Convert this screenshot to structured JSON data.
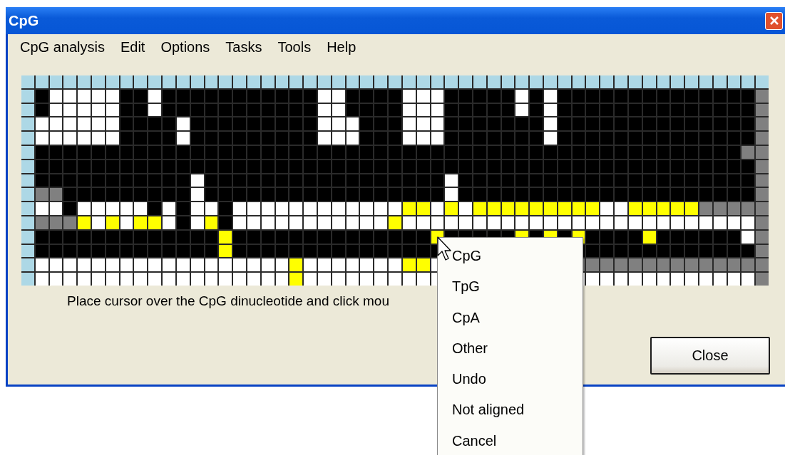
{
  "window": {
    "title": "CpG"
  },
  "menu_bar": [
    "CpG analysis",
    "Edit",
    "Options",
    "Tasks",
    "Tools",
    "Help"
  ],
  "grid": {
    "rows": [
      [
        {
          "color": "#add8e6"
        },
        {
          "color": "#add8e6"
        },
        {
          "color": "#add8e6"
        },
        {
          "color": "#add8e6"
        },
        {
          "color": "#add8e6"
        },
        {
          "color": "#add8e6"
        },
        {
          "color": "#add8e6"
        },
        {
          "color": "#add8e6"
        },
        {
          "color": "#add8e6"
        },
        {
          "color": "#add8e6"
        },
        {
          "color": "#add8e6"
        },
        {
          "color": "#add8e6"
        },
        {
          "color": "#add8e6"
        },
        {
          "color": "#add8e6"
        },
        {
          "color": "#add8e6"
        },
        {
          "color": "#add8e6"
        },
        {
          "color": "#add8e6"
        },
        {
          "color": "#add8e6"
        },
        {
          "color": "#add8e6"
        },
        {
          "color": "#add8e6"
        },
        {
          "color": "#add8e6"
        },
        {
          "color": "#add8e6"
        },
        {
          "color": "#add8e6"
        },
        {
          "color": "#add8e6"
        },
        {
          "color": "#add8e6"
        },
        {
          "color": "#add8e6"
        },
        {
          "color": "#add8e6"
        },
        {
          "color": "#add8e6"
        },
        {
          "color": "#add8e6"
        },
        {
          "color": "#add8e6"
        },
        {
          "color": "#add8e6"
        },
        {
          "color": "#add8e6"
        },
        {
          "color": "#add8e6"
        },
        {
          "color": "#add8e6"
        },
        {
          "color": "#add8e6"
        },
        {
          "color": "#add8e6"
        },
        {
          "color": "#add8e6"
        },
        {
          "color": "#add8e6"
        },
        {
          "color": "#add8e6"
        },
        {
          "color": "#add8e6"
        },
        {
          "color": "#add8e6"
        },
        {
          "color": "#add8e6"
        },
        {
          "color": "#add8e6"
        },
        {
          "color": "#add8e6"
        },
        {
          "color": "#add8e6"
        },
        {
          "color": "#add8e6"
        },
        {
          "color": "#add8e6"
        },
        {
          "color": "#add8e6"
        },
        {
          "color": "#add8e6"
        },
        {
          "color": "#add8e6"
        },
        {
          "color": "#add8e6"
        },
        {
          "color": "#add8e6"
        },
        {
          "color": "#add8e6"
        }
      ],
      [
        {
          "color": "#add8e6"
        },
        {
          "color": "#000000"
        },
        {
          "color": "#ffffff"
        },
        {
          "color": "#ffffff"
        },
        {
          "color": "#ffffff"
        },
        {
          "color": "#ffffff"
        },
        {
          "color": "#ffffff"
        },
        {
          "color": "#000000"
        },
        {
          "color": "#000000"
        },
        {
          "color": "#ffffff"
        },
        {
          "color": "#000000"
        },
        {
          "color": "#000000"
        },
        {
          "color": "#000000"
        },
        {
          "color": "#000000"
        },
        {
          "color": "#000000"
        },
        {
          "color": "#000000"
        },
        {
          "color": "#000000"
        },
        {
          "color": "#000000"
        },
        {
          "color": "#000000"
        },
        {
          "color": "#000000"
        },
        {
          "color": "#000000"
        },
        {
          "color": "#ffffff"
        },
        {
          "color": "#ffffff"
        },
        {
          "color": "#000000"
        },
        {
          "color": "#000000"
        },
        {
          "color": "#000000"
        },
        {
          "color": "#000000"
        },
        {
          "color": "#ffffff"
        },
        {
          "color": "#ffffff"
        },
        {
          "color": "#ffffff"
        },
        {
          "color": "#000000"
        },
        {
          "color": "#000000"
        },
        {
          "color": "#000000"
        },
        {
          "color": "#000000"
        },
        {
          "color": "#000000"
        },
        {
          "color": "#ffffff"
        },
        {
          "color": "#000000"
        },
        {
          "color": "#ffffff"
        },
        {
          "color": "#000000"
        },
        {
          "color": "#000000"
        },
        {
          "color": "#000000"
        },
        {
          "color": "#000000"
        },
        {
          "color": "#000000"
        },
        {
          "color": "#000000"
        },
        {
          "color": "#000000"
        },
        {
          "color": "#000000"
        },
        {
          "color": "#000000"
        },
        {
          "color": "#000000"
        },
        {
          "color": "#000000"
        },
        {
          "color": "#000000"
        },
        {
          "color": "#000000"
        },
        {
          "color": "#000000"
        },
        {
          "color": "#808080"
        }
      ],
      [
        {
          "color": "#add8e6"
        },
        {
          "color": "#000000"
        },
        {
          "color": "#ffffff"
        },
        {
          "color": "#ffffff"
        },
        {
          "color": "#ffffff"
        },
        {
          "color": "#ffffff"
        },
        {
          "color": "#ffffff"
        },
        {
          "color": "#000000"
        },
        {
          "color": "#000000"
        },
        {
          "color": "#ffffff"
        },
        {
          "color": "#000000"
        },
        {
          "color": "#000000"
        },
        {
          "color": "#000000"
        },
        {
          "color": "#000000"
        },
        {
          "color": "#000000"
        },
        {
          "color": "#000000"
        },
        {
          "color": "#000000"
        },
        {
          "color": "#000000"
        },
        {
          "color": "#000000"
        },
        {
          "color": "#000000"
        },
        {
          "color": "#000000"
        },
        {
          "color": "#ffffff"
        },
        {
          "color": "#ffffff"
        },
        {
          "color": "#000000"
        },
        {
          "color": "#000000"
        },
        {
          "color": "#000000"
        },
        {
          "color": "#000000"
        },
        {
          "color": "#ffffff"
        },
        {
          "color": "#ffffff"
        },
        {
          "color": "#ffffff"
        },
        {
          "color": "#000000"
        },
        {
          "color": "#000000"
        },
        {
          "color": "#000000"
        },
        {
          "color": "#000000"
        },
        {
          "color": "#000000"
        },
        {
          "color": "#ffffff"
        },
        {
          "color": "#000000"
        },
        {
          "color": "#ffffff"
        },
        {
          "color": "#000000"
        },
        {
          "color": "#000000"
        },
        {
          "color": "#000000"
        },
        {
          "color": "#000000"
        },
        {
          "color": "#000000"
        },
        {
          "color": "#000000"
        },
        {
          "color": "#000000"
        },
        {
          "color": "#000000"
        },
        {
          "color": "#000000"
        },
        {
          "color": "#000000"
        },
        {
          "color": "#000000"
        },
        {
          "color": "#000000"
        },
        {
          "color": "#000000"
        },
        {
          "color": "#000000"
        },
        {
          "color": "#808080"
        }
      ],
      [
        {
          "color": "#add8e6"
        },
        {
          "color": "#ffffff"
        },
        {
          "color": "#ffffff"
        },
        {
          "color": "#ffffff"
        },
        {
          "color": "#ffffff"
        },
        {
          "color": "#ffffff"
        },
        {
          "color": "#ffffff"
        },
        {
          "color": "#000000"
        },
        {
          "color": "#000000"
        },
        {
          "color": "#000000"
        },
        {
          "color": "#000000"
        },
        {
          "color": "#ffffff"
        },
        {
          "color": "#000000"
        },
        {
          "color": "#000000"
        },
        {
          "color": "#000000"
        },
        {
          "color": "#000000"
        },
        {
          "color": "#000000"
        },
        {
          "color": "#000000"
        },
        {
          "color": "#000000"
        },
        {
          "color": "#000000"
        },
        {
          "color": "#000000"
        },
        {
          "color": "#ffffff"
        },
        {
          "color": "#ffffff"
        },
        {
          "color": "#ffffff"
        },
        {
          "color": "#000000"
        },
        {
          "color": "#000000"
        },
        {
          "color": "#000000"
        },
        {
          "color": "#ffffff"
        },
        {
          "color": "#ffffff"
        },
        {
          "color": "#ffffff"
        },
        {
          "color": "#000000"
        },
        {
          "color": "#000000"
        },
        {
          "color": "#000000"
        },
        {
          "color": "#000000"
        },
        {
          "color": "#000000"
        },
        {
          "color": "#000000"
        },
        {
          "color": "#000000"
        },
        {
          "color": "#ffffff"
        },
        {
          "color": "#000000"
        },
        {
          "color": "#000000"
        },
        {
          "color": "#000000"
        },
        {
          "color": "#000000"
        },
        {
          "color": "#000000"
        },
        {
          "color": "#000000"
        },
        {
          "color": "#000000"
        },
        {
          "color": "#000000"
        },
        {
          "color": "#000000"
        },
        {
          "color": "#000000"
        },
        {
          "color": "#000000"
        },
        {
          "color": "#000000"
        },
        {
          "color": "#000000"
        },
        {
          "color": "#000000"
        },
        {
          "color": "#808080"
        }
      ],
      [
        {
          "color": "#add8e6"
        },
        {
          "color": "#ffffff"
        },
        {
          "color": "#ffffff"
        },
        {
          "color": "#ffffff"
        },
        {
          "color": "#ffffff"
        },
        {
          "color": "#ffffff"
        },
        {
          "color": "#ffffff"
        },
        {
          "color": "#000000"
        },
        {
          "color": "#000000"
        },
        {
          "color": "#000000"
        },
        {
          "color": "#000000"
        },
        {
          "color": "#ffffff"
        },
        {
          "color": "#000000"
        },
        {
          "color": "#000000"
        },
        {
          "color": "#000000"
        },
        {
          "color": "#000000"
        },
        {
          "color": "#000000"
        },
        {
          "color": "#000000"
        },
        {
          "color": "#000000"
        },
        {
          "color": "#000000"
        },
        {
          "color": "#000000"
        },
        {
          "color": "#ffffff"
        },
        {
          "color": "#ffffff"
        },
        {
          "color": "#ffffff"
        },
        {
          "color": "#000000"
        },
        {
          "color": "#000000"
        },
        {
          "color": "#000000"
        },
        {
          "color": "#ffffff"
        },
        {
          "color": "#ffffff"
        },
        {
          "color": "#ffffff"
        },
        {
          "color": "#000000"
        },
        {
          "color": "#000000"
        },
        {
          "color": "#000000"
        },
        {
          "color": "#000000"
        },
        {
          "color": "#000000"
        },
        {
          "color": "#000000"
        },
        {
          "color": "#000000"
        },
        {
          "color": "#ffffff"
        },
        {
          "color": "#000000"
        },
        {
          "color": "#000000"
        },
        {
          "color": "#000000"
        },
        {
          "color": "#000000"
        },
        {
          "color": "#000000"
        },
        {
          "color": "#000000"
        },
        {
          "color": "#000000"
        },
        {
          "color": "#000000"
        },
        {
          "color": "#000000"
        },
        {
          "color": "#000000"
        },
        {
          "color": "#000000"
        },
        {
          "color": "#000000"
        },
        {
          "color": "#000000"
        },
        {
          "color": "#000000"
        },
        {
          "color": "#808080"
        }
      ],
      [
        {
          "color": "#add8e6"
        },
        {
          "color": "#000000"
        },
        {
          "color": "#000000"
        },
        {
          "color": "#000000"
        },
        {
          "color": "#000000"
        },
        {
          "color": "#000000"
        },
        {
          "color": "#000000"
        },
        {
          "color": "#000000"
        },
        {
          "color": "#000000"
        },
        {
          "color": "#000000"
        },
        {
          "color": "#000000"
        },
        {
          "color": "#000000"
        },
        {
          "color": "#000000"
        },
        {
          "color": "#000000"
        },
        {
          "color": "#000000"
        },
        {
          "color": "#000000"
        },
        {
          "color": "#000000"
        },
        {
          "color": "#000000"
        },
        {
          "color": "#000000"
        },
        {
          "color": "#000000"
        },
        {
          "color": "#000000"
        },
        {
          "color": "#000000"
        },
        {
          "color": "#000000"
        },
        {
          "color": "#000000"
        },
        {
          "color": "#000000"
        },
        {
          "color": "#000000"
        },
        {
          "color": "#000000"
        },
        {
          "color": "#000000"
        },
        {
          "color": "#000000"
        },
        {
          "color": "#000000"
        },
        {
          "color": "#000000"
        },
        {
          "color": "#000000"
        },
        {
          "color": "#000000"
        },
        {
          "color": "#000000"
        },
        {
          "color": "#000000"
        },
        {
          "color": "#000000"
        },
        {
          "color": "#000000"
        },
        {
          "color": "#000000"
        },
        {
          "color": "#000000"
        },
        {
          "color": "#000000"
        },
        {
          "color": "#000000"
        },
        {
          "color": "#000000"
        },
        {
          "color": "#000000"
        },
        {
          "color": "#000000"
        },
        {
          "color": "#000000"
        },
        {
          "color": "#000000"
        },
        {
          "color": "#000000"
        },
        {
          "color": "#000000"
        },
        {
          "color": "#000000"
        },
        {
          "color": "#000000"
        },
        {
          "color": "#000000"
        },
        {
          "color": "#808080"
        },
        {
          "color": "#808080"
        }
      ],
      [
        {
          "color": "#add8e6"
        },
        {
          "color": "#000000"
        },
        {
          "color": "#000000"
        },
        {
          "color": "#000000"
        },
        {
          "color": "#000000"
        },
        {
          "color": "#000000"
        },
        {
          "color": "#000000"
        },
        {
          "color": "#000000"
        },
        {
          "color": "#000000"
        },
        {
          "color": "#000000"
        },
        {
          "color": "#000000"
        },
        {
          "color": "#000000"
        },
        {
          "color": "#000000"
        },
        {
          "color": "#000000"
        },
        {
          "color": "#000000"
        },
        {
          "color": "#000000"
        },
        {
          "color": "#000000"
        },
        {
          "color": "#000000"
        },
        {
          "color": "#000000"
        },
        {
          "color": "#000000"
        },
        {
          "color": "#000000"
        },
        {
          "color": "#000000"
        },
        {
          "color": "#000000"
        },
        {
          "color": "#000000"
        },
        {
          "color": "#000000"
        },
        {
          "color": "#000000"
        },
        {
          "color": "#000000"
        },
        {
          "color": "#000000"
        },
        {
          "color": "#000000"
        },
        {
          "color": "#000000"
        },
        {
          "color": "#000000"
        },
        {
          "color": "#000000"
        },
        {
          "color": "#000000"
        },
        {
          "color": "#000000"
        },
        {
          "color": "#000000"
        },
        {
          "color": "#000000"
        },
        {
          "color": "#000000"
        },
        {
          "color": "#000000"
        },
        {
          "color": "#000000"
        },
        {
          "color": "#000000"
        },
        {
          "color": "#000000"
        },
        {
          "color": "#000000"
        },
        {
          "color": "#000000"
        },
        {
          "color": "#000000"
        },
        {
          "color": "#000000"
        },
        {
          "color": "#000000"
        },
        {
          "color": "#000000"
        },
        {
          "color": "#000000"
        },
        {
          "color": "#000000"
        },
        {
          "color": "#000000"
        },
        {
          "color": "#000000"
        },
        {
          "color": "#000000"
        },
        {
          "color": "#808080"
        }
      ],
      [
        {
          "color": "#add8e6"
        },
        {
          "color": "#000000"
        },
        {
          "color": "#000000"
        },
        {
          "color": "#000000"
        },
        {
          "color": "#000000"
        },
        {
          "color": "#000000"
        },
        {
          "color": "#000000"
        },
        {
          "color": "#000000"
        },
        {
          "color": "#000000"
        },
        {
          "color": "#000000"
        },
        {
          "color": "#000000"
        },
        {
          "color": "#000000"
        },
        {
          "color": "#ffffff"
        },
        {
          "color": "#000000"
        },
        {
          "color": "#000000"
        },
        {
          "color": "#000000"
        },
        {
          "color": "#000000"
        },
        {
          "color": "#000000"
        },
        {
          "color": "#000000"
        },
        {
          "color": "#000000"
        },
        {
          "color": "#000000"
        },
        {
          "color": "#000000"
        },
        {
          "color": "#000000"
        },
        {
          "color": "#000000"
        },
        {
          "color": "#000000"
        },
        {
          "color": "#000000"
        },
        {
          "color": "#000000"
        },
        {
          "color": "#000000"
        },
        {
          "color": "#000000"
        },
        {
          "color": "#000000"
        },
        {
          "color": "#ffffff"
        },
        {
          "color": "#000000"
        },
        {
          "color": "#000000"
        },
        {
          "color": "#000000"
        },
        {
          "color": "#000000"
        },
        {
          "color": "#000000"
        },
        {
          "color": "#000000"
        },
        {
          "color": "#000000"
        },
        {
          "color": "#000000"
        },
        {
          "color": "#000000"
        },
        {
          "color": "#000000"
        },
        {
          "color": "#000000"
        },
        {
          "color": "#000000"
        },
        {
          "color": "#000000"
        },
        {
          "color": "#000000"
        },
        {
          "color": "#000000"
        },
        {
          "color": "#000000"
        },
        {
          "color": "#000000"
        },
        {
          "color": "#000000"
        },
        {
          "color": "#000000"
        },
        {
          "color": "#000000"
        },
        {
          "color": "#000000"
        },
        {
          "color": "#808080"
        }
      ],
      [
        {
          "color": "#add8e6"
        },
        {
          "color": "#808080"
        },
        {
          "color": "#808080"
        },
        {
          "color": "#000000"
        },
        {
          "color": "#000000"
        },
        {
          "color": "#000000"
        },
        {
          "color": "#000000"
        },
        {
          "color": "#000000"
        },
        {
          "color": "#000000"
        },
        {
          "color": "#000000"
        },
        {
          "color": "#000000"
        },
        {
          "color": "#000000"
        },
        {
          "color": "#ffffff"
        },
        {
          "color": "#000000"
        },
        {
          "color": "#000000"
        },
        {
          "color": "#000000"
        },
        {
          "color": "#000000"
        },
        {
          "color": "#000000"
        },
        {
          "color": "#000000"
        },
        {
          "color": "#000000"
        },
        {
          "color": "#000000"
        },
        {
          "color": "#000000"
        },
        {
          "color": "#000000"
        },
        {
          "color": "#000000"
        },
        {
          "color": "#000000"
        },
        {
          "color": "#000000"
        },
        {
          "color": "#000000"
        },
        {
          "color": "#000000"
        },
        {
          "color": "#000000"
        },
        {
          "color": "#000000"
        },
        {
          "color": "#ffffff"
        },
        {
          "color": "#000000"
        },
        {
          "color": "#000000"
        },
        {
          "color": "#000000"
        },
        {
          "color": "#000000"
        },
        {
          "color": "#000000"
        },
        {
          "color": "#000000"
        },
        {
          "color": "#000000"
        },
        {
          "color": "#000000"
        },
        {
          "color": "#000000"
        },
        {
          "color": "#000000"
        },
        {
          "color": "#000000"
        },
        {
          "color": "#000000"
        },
        {
          "color": "#000000"
        },
        {
          "color": "#000000"
        },
        {
          "color": "#000000"
        },
        {
          "color": "#000000"
        },
        {
          "color": "#000000"
        },
        {
          "color": "#000000"
        },
        {
          "color": "#000000"
        },
        {
          "color": "#000000"
        },
        {
          "color": "#000000"
        },
        {
          "color": "#808080"
        }
      ],
      [
        {
          "color": "#add8e6"
        },
        {
          "color": "#ffffff"
        },
        {
          "color": "#ffffff"
        },
        {
          "color": "#000000"
        },
        {
          "color": "#ffffff"
        },
        {
          "color": "#ffffff"
        },
        {
          "color": "#ffffff"
        },
        {
          "color": "#ffffff"
        },
        {
          "color": "#ffffff"
        },
        {
          "color": "#000000"
        },
        {
          "color": "#ffffff"
        },
        {
          "color": "#000000"
        },
        {
          "color": "#ffffff"
        },
        {
          "color": "#ffffff"
        },
        {
          "color": "#000000"
        },
        {
          "color": "#ffffff"
        },
        {
          "color": "#ffffff"
        },
        {
          "color": "#ffffff"
        },
        {
          "color": "#ffffff"
        },
        {
          "color": "#ffffff"
        },
        {
          "color": "#ffffff"
        },
        {
          "color": "#ffffff"
        },
        {
          "color": "#ffffff"
        },
        {
          "color": "#ffffff"
        },
        {
          "color": "#ffffff"
        },
        {
          "color": "#ffffff"
        },
        {
          "color": "#ffffff"
        },
        {
          "color": "#ffff00"
        },
        {
          "color": "#ffff00"
        },
        {
          "color": "#ffffff"
        },
        {
          "color": "#ffff00"
        },
        {
          "color": "#ffffff"
        },
        {
          "color": "#ffff00"
        },
        {
          "color": "#ffff00"
        },
        {
          "color": "#ffff00"
        },
        {
          "color": "#ffff00"
        },
        {
          "color": "#ffff00"
        },
        {
          "color": "#ffff00"
        },
        {
          "color": "#ffff00"
        },
        {
          "color": "#ffff00"
        },
        {
          "color": "#ffff00"
        },
        {
          "color": "#ffffff"
        },
        {
          "color": "#ffffff"
        },
        {
          "color": "#ffff00"
        },
        {
          "color": "#ffff00"
        },
        {
          "color": "#ffff00"
        },
        {
          "color": "#ffff00"
        },
        {
          "color": "#ffff00"
        },
        {
          "color": "#808080"
        },
        {
          "color": "#808080"
        },
        {
          "color": "#808080"
        },
        {
          "color": "#808080"
        },
        {
          "color": "#808080"
        }
      ],
      [
        {
          "color": "#add8e6"
        },
        {
          "color": "#808080"
        },
        {
          "color": "#808080"
        },
        {
          "color": "#808080"
        },
        {
          "color": "#ffff00"
        },
        {
          "color": "#ffffff"
        },
        {
          "color": "#ffff00"
        },
        {
          "color": "#ffffff"
        },
        {
          "color": "#ffff00"
        },
        {
          "color": "#ffff00"
        },
        {
          "color": "#ffffff"
        },
        {
          "color": "#000000"
        },
        {
          "color": "#ffffff"
        },
        {
          "color": "#ffff00"
        },
        {
          "color": "#000000"
        },
        {
          "color": "#ffffff"
        },
        {
          "color": "#ffffff"
        },
        {
          "color": "#ffffff"
        },
        {
          "color": "#ffffff"
        },
        {
          "color": "#ffffff"
        },
        {
          "color": "#ffffff"
        },
        {
          "color": "#ffffff"
        },
        {
          "color": "#ffffff"
        },
        {
          "color": "#ffffff"
        },
        {
          "color": "#ffffff"
        },
        {
          "color": "#ffffff"
        },
        {
          "color": "#ffff00"
        },
        {
          "color": "#ffffff"
        },
        {
          "color": "#ffffff"
        },
        {
          "color": "#ffffff"
        },
        {
          "color": "#ffffff"
        },
        {
          "color": "#ffffff"
        },
        {
          "color": "#ffffff"
        },
        {
          "color": "#ffffff"
        },
        {
          "color": "#ffffff"
        },
        {
          "color": "#ffffff"
        },
        {
          "color": "#ffffff"
        },
        {
          "color": "#ffffff"
        },
        {
          "color": "#ffffff"
        },
        {
          "color": "#ffffff"
        },
        {
          "color": "#ffffff"
        },
        {
          "color": "#ffffff"
        },
        {
          "color": "#ffffff"
        },
        {
          "color": "#ffffff"
        },
        {
          "color": "#ffffff"
        },
        {
          "color": "#ffffff"
        },
        {
          "color": "#ffffff"
        },
        {
          "color": "#ffffff"
        },
        {
          "color": "#ffffff"
        },
        {
          "color": "#ffffff"
        },
        {
          "color": "#ffffff"
        },
        {
          "color": "#ffffff"
        },
        {
          "color": "#808080"
        }
      ],
      [
        {
          "color": "#add8e6"
        },
        {
          "color": "#000000"
        },
        {
          "color": "#000000"
        },
        {
          "color": "#000000"
        },
        {
          "color": "#000000"
        },
        {
          "color": "#000000"
        },
        {
          "color": "#000000"
        },
        {
          "color": "#000000"
        },
        {
          "color": "#000000"
        },
        {
          "color": "#000000"
        },
        {
          "color": "#000000"
        },
        {
          "color": "#000000"
        },
        {
          "color": "#000000"
        },
        {
          "color": "#000000"
        },
        {
          "color": "#ffff00"
        },
        {
          "color": "#000000"
        },
        {
          "color": "#000000"
        },
        {
          "color": "#000000"
        },
        {
          "color": "#000000"
        },
        {
          "color": "#000000"
        },
        {
          "color": "#000000"
        },
        {
          "color": "#000000"
        },
        {
          "color": "#000000"
        },
        {
          "color": "#000000"
        },
        {
          "color": "#000000"
        },
        {
          "color": "#000000"
        },
        {
          "color": "#000000"
        },
        {
          "color": "#000000"
        },
        {
          "color": "#000000"
        },
        {
          "color": "#ffff00"
        },
        {
          "color": "#000000"
        },
        {
          "color": "#000000"
        },
        {
          "color": "#000000"
        },
        {
          "color": "#000000"
        },
        {
          "color": "#000000"
        },
        {
          "color": "#ffff00"
        },
        {
          "color": "#000000"
        },
        {
          "color": "#ffff00"
        },
        {
          "color": "#000000"
        },
        {
          "color": "#ffff00"
        },
        {
          "color": "#000000"
        },
        {
          "color": "#000000"
        },
        {
          "color": "#000000"
        },
        {
          "color": "#000000"
        },
        {
          "color": "#ffff00"
        },
        {
          "color": "#000000"
        },
        {
          "color": "#000000"
        },
        {
          "color": "#000000"
        },
        {
          "color": "#000000"
        },
        {
          "color": "#000000"
        },
        {
          "color": "#000000"
        },
        {
          "color": "#ffffff"
        },
        {
          "color": "#808080"
        }
      ],
      [
        {
          "color": "#add8e6"
        },
        {
          "color": "#000000"
        },
        {
          "color": "#000000"
        },
        {
          "color": "#000000"
        },
        {
          "color": "#000000"
        },
        {
          "color": "#000000"
        },
        {
          "color": "#000000"
        },
        {
          "color": "#000000"
        },
        {
          "color": "#000000"
        },
        {
          "color": "#000000"
        },
        {
          "color": "#000000"
        },
        {
          "color": "#000000"
        },
        {
          "color": "#000000"
        },
        {
          "color": "#000000"
        },
        {
          "color": "#ffff00"
        },
        {
          "color": "#000000"
        },
        {
          "color": "#000000"
        },
        {
          "color": "#000000"
        },
        {
          "color": "#000000"
        },
        {
          "color": "#000000"
        },
        {
          "color": "#000000"
        },
        {
          "color": "#000000"
        },
        {
          "color": "#000000"
        },
        {
          "color": "#000000"
        },
        {
          "color": "#000000"
        },
        {
          "color": "#000000"
        },
        {
          "color": "#000000"
        },
        {
          "color": "#000000"
        },
        {
          "color": "#000000"
        },
        {
          "color": "#000000"
        },
        null,
        null,
        null,
        null,
        null,
        null,
        null,
        null,
        null,
        {
          "color": "#000000"
        },
        {
          "color": "#000000"
        },
        {
          "color": "#000000"
        },
        {
          "color": "#000000"
        },
        {
          "color": "#000000"
        },
        {
          "color": "#000000"
        },
        {
          "color": "#000000"
        },
        {
          "color": "#000000"
        },
        {
          "color": "#000000"
        },
        {
          "color": "#000000"
        },
        {
          "color": "#000000"
        },
        {
          "color": "#000000"
        },
        {
          "color": "#000000"
        },
        {
          "color": "#808080"
        }
      ],
      [
        {
          "color": "#add8e6"
        },
        {
          "color": "#ffffff"
        },
        {
          "color": "#ffffff"
        },
        {
          "color": "#ffffff"
        },
        {
          "color": "#ffffff"
        },
        {
          "color": "#ffffff"
        },
        {
          "color": "#ffffff"
        },
        {
          "color": "#ffffff"
        },
        {
          "color": "#ffffff"
        },
        {
          "color": "#ffffff"
        },
        {
          "color": "#ffffff"
        },
        {
          "color": "#ffffff"
        },
        {
          "color": "#ffffff"
        },
        {
          "color": "#ffffff"
        },
        {
          "color": "#ffffff"
        },
        {
          "color": "#ffffff"
        },
        {
          "color": "#ffffff"
        },
        {
          "color": "#ffffff"
        },
        {
          "color": "#ffffff"
        },
        {
          "color": "#ffff00"
        },
        {
          "color": "#ffffff"
        },
        {
          "color": "#ffffff"
        },
        {
          "color": "#ffffff"
        },
        {
          "color": "#ffffff"
        },
        {
          "color": "#ffffff"
        },
        {
          "color": "#ffffff"
        },
        {
          "color": "#ffffff"
        },
        {
          "color": "#ffff00"
        },
        {
          "color": "#ffff00"
        },
        {
          "color": "#ffffff"
        },
        null,
        null,
        null,
        null,
        null,
        null,
        null,
        null,
        null,
        {
          "color": "#808080"
        },
        {
          "color": "#808080"
        },
        {
          "color": "#808080"
        },
        {
          "color": "#808080"
        },
        {
          "color": "#808080"
        },
        {
          "color": "#808080"
        },
        {
          "color": "#808080"
        },
        {
          "color": "#808080"
        },
        {
          "color": "#808080"
        },
        {
          "color": "#808080"
        },
        {
          "color": "#808080"
        },
        {
          "color": "#808080"
        },
        {
          "color": "#808080"
        },
        {
          "color": "#808080"
        }
      ],
      [
        {
          "color": "#add8e6"
        },
        {
          "color": "#ffffff"
        },
        {
          "color": "#ffffff"
        },
        {
          "color": "#ffffff"
        },
        {
          "color": "#ffffff"
        },
        {
          "color": "#ffffff"
        },
        {
          "color": "#ffffff"
        },
        {
          "color": "#ffffff"
        },
        {
          "color": "#ffffff"
        },
        {
          "color": "#ffffff"
        },
        {
          "color": "#ffffff"
        },
        {
          "color": "#ffffff"
        },
        {
          "color": "#ffffff"
        },
        {
          "color": "#ffffff"
        },
        {
          "color": "#ffffff"
        },
        {
          "color": "#ffffff"
        },
        {
          "color": "#ffffff"
        },
        {
          "color": "#ffffff"
        },
        {
          "color": "#ffffff"
        },
        {
          "color": "#ffff00"
        },
        {
          "color": "#ffffff"
        },
        {
          "color": "#ffffff"
        },
        {
          "color": "#ffffff"
        },
        {
          "color": "#ffffff"
        },
        {
          "color": "#ffffff"
        },
        {
          "color": "#ffffff"
        },
        {
          "color": "#ffffff"
        },
        {
          "color": "#ffffff"
        },
        {
          "color": "#ffffff"
        },
        {
          "color": "#ffffff"
        },
        null,
        null,
        null,
        null,
        null,
        null,
        null,
        null,
        null,
        {
          "color": "#ffffff"
        },
        {
          "color": "#ffffff"
        },
        {
          "color": "#ffffff"
        },
        {
          "color": "#ffffff"
        },
        {
          "color": "#ffffff"
        },
        {
          "color": "#ffffff"
        },
        {
          "color": "#ffffff"
        },
        {
          "color": "#ffffff"
        },
        {
          "color": "#ffffff"
        },
        {
          "color": "#ffffff"
        },
        {
          "color": "#ffffff"
        },
        {
          "color": "#ffffff"
        },
        {
          "color": "#ffffff"
        },
        {
          "color": "#808080"
        }
      ]
    ]
  },
  "instruction": "Place cursor over the CpG dinucleotide and click mou",
  "buttons": [
    "Close"
  ],
  "context_menu": [
    "CpG",
    "TpG",
    "CpA",
    "Other",
    "Undo",
    "Not aligned",
    "Cancel"
  ]
}
